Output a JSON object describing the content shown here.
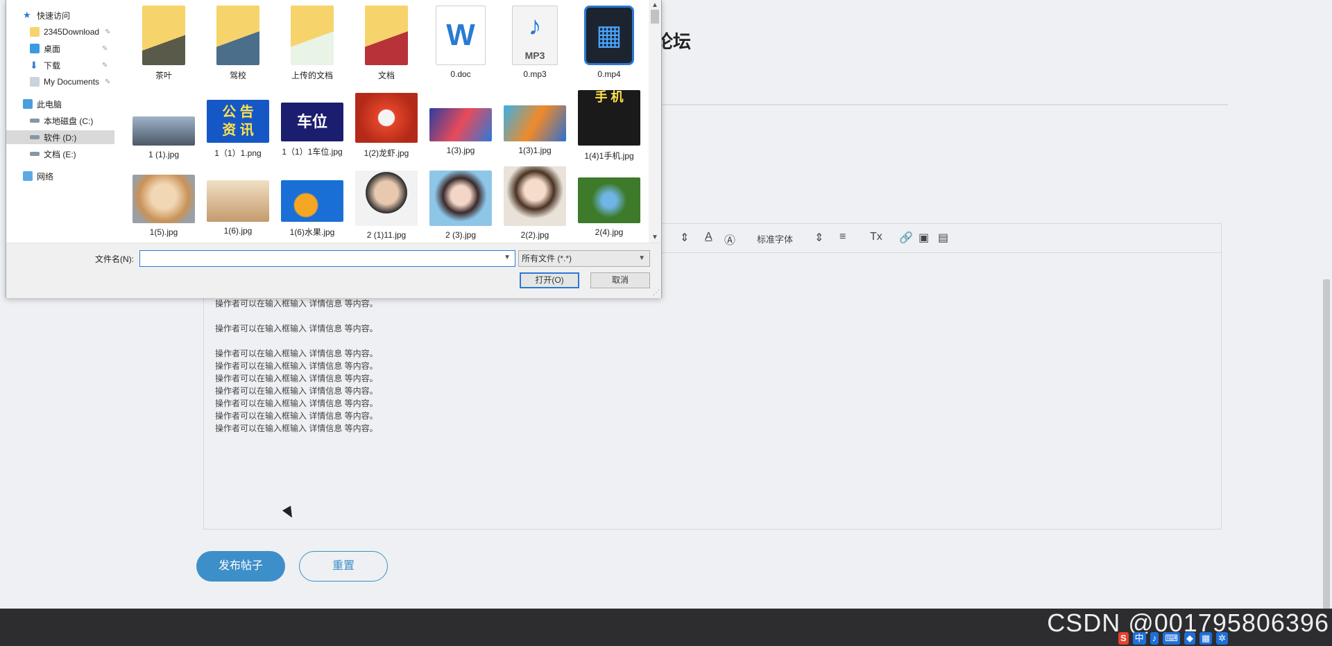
{
  "page": {
    "title": "论坛",
    "editor": {
      "font_select": "标准字体",
      "lines": [
        "操作者可以在输入框输入 详情信息 等内容。",
        "",
        "操作者可以在输入框输入 详情信息 等内容。",
        "",
        "操作者可以在输入框输入 详情信息 等内容。",
        "操作者可以在输入框输入 详情信息 等内容。",
        "操作者可以在输入框输入 详情信息 等内容。",
        "操作者可以在输入框输入 详情信息 等内容。",
        "操作者可以在输入框输入 详情信息 等内容。",
        "操作者可以在输入框输入 详情信息 等内容。",
        "操作者可以在输入框输入 详情信息 等内容。"
      ]
    },
    "submit_label": "发布帖子",
    "reset_label": "重置",
    "watermark": "CSDN @001795806396",
    "ime": {
      "sogou": "S",
      "lang": "中"
    }
  },
  "dialog": {
    "nav": {
      "quick_access": "快速访问",
      "items": [
        "2345Download",
        "桌面",
        "下载",
        "My Documents"
      ],
      "this_pc": "此电脑",
      "drives": [
        "本地磁盘 (C:)",
        "软件 (D:)",
        "文档 (E:)"
      ],
      "network": "网络"
    },
    "files": [
      {
        "name": "茶叶",
        "kind": "folder"
      },
      {
        "name": "驾校",
        "kind": "folder"
      },
      {
        "name": "上传的文档",
        "kind": "folder"
      },
      {
        "name": "文档",
        "kind": "folder"
      },
      {
        "name": "0.doc",
        "kind": "doc"
      },
      {
        "name": "0.mp3",
        "kind": "mp3",
        "badge": "MP3"
      },
      {
        "name": "0.mp4",
        "kind": "mp4"
      },
      {
        "name": "1 (1).jpg",
        "kind": "image"
      },
      {
        "name": "1（1）1.png",
        "kind": "text-image",
        "text": "公 告\n资 讯"
      },
      {
        "name": "1（1）1车位.jpg",
        "kind": "text-image",
        "text": "车位"
      },
      {
        "name": "1(2)龙虾.jpg",
        "kind": "image"
      },
      {
        "name": "1(3).jpg",
        "kind": "image"
      },
      {
        "name": "1(3)1.jpg",
        "kind": "image"
      },
      {
        "name": "1(4)1手机.jpg",
        "kind": "text-image",
        "text": "手 机"
      },
      {
        "name": "1(5).jpg",
        "kind": "image"
      },
      {
        "name": "1(6).jpg",
        "kind": "image"
      },
      {
        "name": "1(6)水果.jpg",
        "kind": "image"
      },
      {
        "name": "2 (1)11.jpg",
        "kind": "image"
      },
      {
        "name": "2 (3).jpg",
        "kind": "image"
      },
      {
        "name": "2(2).jpg",
        "kind": "image"
      },
      {
        "name": "2(4).jpg",
        "kind": "image"
      }
    ],
    "filename_label": "文件名(N):",
    "filename_value": "",
    "filetype": "所有文件 (*.*)",
    "open_label": "打开(O)",
    "cancel_label": "取消"
  }
}
